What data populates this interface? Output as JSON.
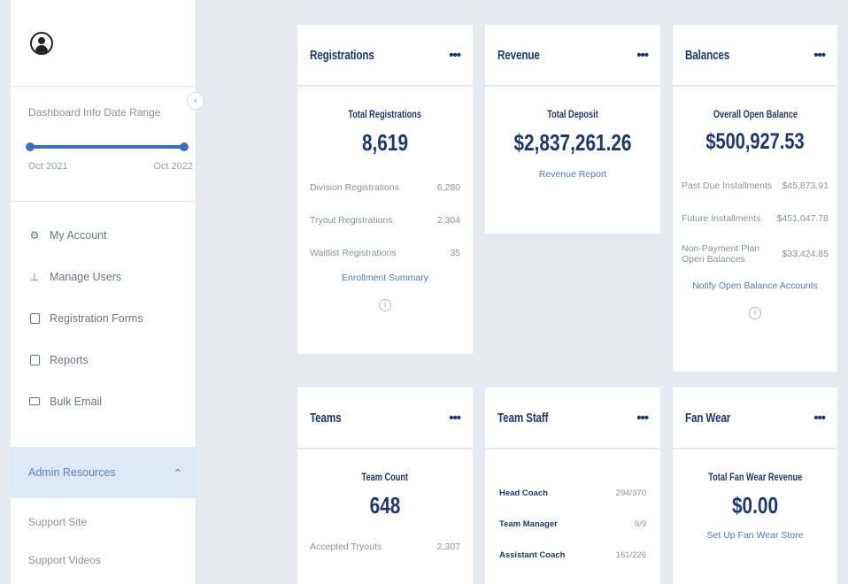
{
  "sidebar": {
    "date_range_label": "Dashboard Info Date Range",
    "range_start": "Oct 2021",
    "range_end": "Oct 2022",
    "menu": [
      {
        "label": "My Account",
        "icon": "account-icon"
      },
      {
        "label": "Manage Users",
        "icon": "user-icon"
      },
      {
        "label": "Registration Forms",
        "icon": "form-icon"
      },
      {
        "label": "Reports",
        "icon": "report-icon"
      },
      {
        "label": "Bulk Email",
        "icon": "mail-icon"
      }
    ],
    "admin_resources": "Admin Resources",
    "sub_items": [
      "Support Site",
      "Support Videos"
    ]
  },
  "cards": {
    "registrations": {
      "title": "Registrations",
      "metric_label": "Total Registrations",
      "metric_value": "8,619",
      "rows": [
        {
          "label": "Division Registrations",
          "value": "6,280"
        },
        {
          "label": "Tryout Registrations",
          "value": "2,304"
        },
        {
          "label": "Waitlist Registrations",
          "value": "35"
        }
      ],
      "link": "Enrollment Summary"
    },
    "revenue": {
      "title": "Revenue",
      "metric_label": "Total Deposit",
      "metric_value": "$2,837,261.26",
      "link": "Revenue Report"
    },
    "balances": {
      "title": "Balances",
      "metric_label": "Overall Open Balance",
      "metric_value": "$500,927.53",
      "rows": [
        {
          "label": "Past Due Installments",
          "value": "$45,873.91"
        },
        {
          "label": "Future Installments",
          "value": "$451,047.78"
        },
        {
          "label": "Non-Payment Plan Open Balances",
          "value": "$33,424.85"
        }
      ],
      "link": "Notify Open Balance Accounts"
    },
    "teams": {
      "title": "Teams",
      "metric_label": "Team Count",
      "metric_value": "648",
      "rows": [
        {
          "label": "Accepted Tryouts",
          "value": "2,307"
        }
      ]
    },
    "team_staff": {
      "title": "Team Staff",
      "rows": [
        {
          "label": "Head Coach",
          "value": "294/370"
        },
        {
          "label": "Team Manager",
          "value": "9/9"
        },
        {
          "label": "Assistant Coach",
          "value": "161/226"
        }
      ]
    },
    "fan_wear": {
      "title": "Fan Wear",
      "metric_label": "Total Fan Wear Revenue",
      "metric_value": "$0.00",
      "link": "Set Up Fan Wear Store"
    }
  },
  "colors": {
    "navy": "#1f3770",
    "link": "#4f78c2",
    "accent": "#3d6fc1",
    "admin_bg": "#dfe8f6"
  }
}
